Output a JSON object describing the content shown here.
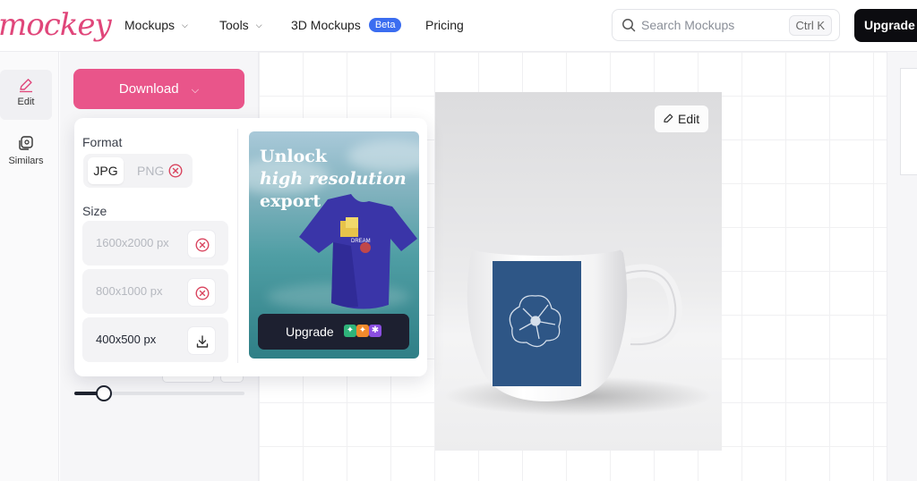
{
  "brand": {
    "logo_text": "mockey",
    "accent": "#e9558a"
  },
  "nav": {
    "items": [
      {
        "label": "Mockups",
        "has_dropdown": true
      },
      {
        "label": "Tools",
        "has_dropdown": true
      },
      {
        "label": "3D Mockups",
        "badge": "Beta"
      },
      {
        "label": "Pricing"
      }
    ]
  },
  "search": {
    "placeholder": "Search Mockups",
    "shortcut": "Ctrl K"
  },
  "header": {
    "upgrade_label": "Upgrade"
  },
  "rail": {
    "items": [
      {
        "label": "Edit",
        "icon": "pencil-icon",
        "active": true
      },
      {
        "label": "Similars",
        "icon": "layers-icon",
        "active": false
      }
    ]
  },
  "panel": {
    "download_label": "Download",
    "slider_value": 0.17
  },
  "popover": {
    "format_label": "Format",
    "formats": [
      {
        "label": "JPG",
        "selected": true,
        "available": true
      },
      {
        "label": "PNG",
        "selected": false,
        "available": false
      }
    ],
    "size_label": "Size",
    "sizes": [
      {
        "label": "1600x2000 px",
        "available": false
      },
      {
        "label": "800x1000 px",
        "available": false
      },
      {
        "label": "400x500 px",
        "available": true
      }
    ],
    "promo": {
      "line1": "Unlock",
      "line2": "high resolution",
      "line3": "export",
      "button_label": "Upgrade"
    }
  },
  "canvas": {
    "edit_label": "Edit",
    "mug_color": "#ffffff",
    "print_color": "#2e5686"
  }
}
